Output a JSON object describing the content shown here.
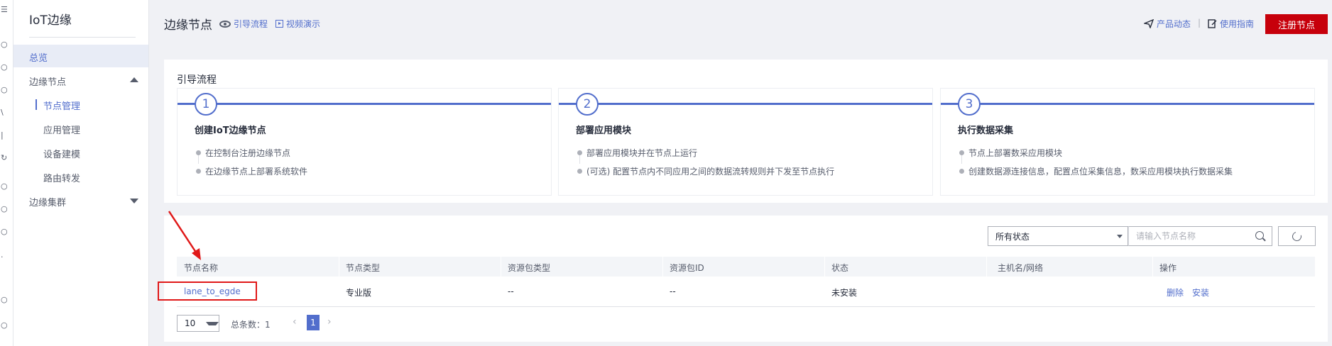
{
  "rail": {
    "glyphs": [
      "☰",
      "○",
      "○",
      "○",
      "\\",
      "|",
      "↻",
      "○",
      "○",
      "○",
      "·",
      "○",
      "○"
    ]
  },
  "sidebar": {
    "title": "IoT边缘",
    "items": [
      {
        "label": "总览",
        "active": true
      },
      {
        "label": "边缘节点",
        "expanded": true
      },
      {
        "label": "节点管理",
        "active": true
      },
      {
        "label": "应用管理"
      },
      {
        "label": "设备建模"
      },
      {
        "label": "路由转发"
      },
      {
        "label": "边缘集群",
        "expanded": false
      }
    ]
  },
  "header": {
    "title": "边缘节点",
    "guide_link": "引导流程",
    "video_link": "视频演示",
    "product_news": "产品动态",
    "separator": "|",
    "usage_guide": "使用指南",
    "register_button": "注册节点"
  },
  "guide": {
    "title": "引导流程",
    "steps": [
      {
        "num": "1",
        "title": "创建IoT边缘节点",
        "bullets": [
          "在控制台注册边缘节点",
          "在边缘节点上部署系统软件"
        ]
      },
      {
        "num": "2",
        "title": "部署应用模块",
        "bullets": [
          "部署应用模块并在节点上运行",
          "(可选) 配置节点内不同应用之间的数据流转规则并下发至节点执行"
        ]
      },
      {
        "num": "3",
        "title": "执行数据采集",
        "bullets": [
          "节点上部署数采应用模块",
          "创建数据源连接信息，配置点位采集信息，数采应用模块执行数据采集"
        ]
      }
    ]
  },
  "filter": {
    "status_selected": "所有状态",
    "search_placeholder": "请输入节点名称"
  },
  "table": {
    "columns": [
      "节点名称",
      "节点类型",
      "资源包类型",
      "资源包ID",
      "状态",
      "主机名/网络",
      "操作"
    ],
    "rows": [
      {
        "name": "lane_to_egde",
        "type": "专业版",
        "pkg_type": "--",
        "pkg_id": "--",
        "status": "未安装",
        "host": "",
        "actions": [
          "删除",
          "安装"
        ]
      }
    ]
  },
  "pager": {
    "page_size": "10",
    "total_label": "总条数：1",
    "prev": "‹",
    "current_page": "1",
    "next": "›"
  },
  "colors": {
    "accent": "#526ecc",
    "primary_button": "#c7000b",
    "annotation": "#e01818"
  }
}
